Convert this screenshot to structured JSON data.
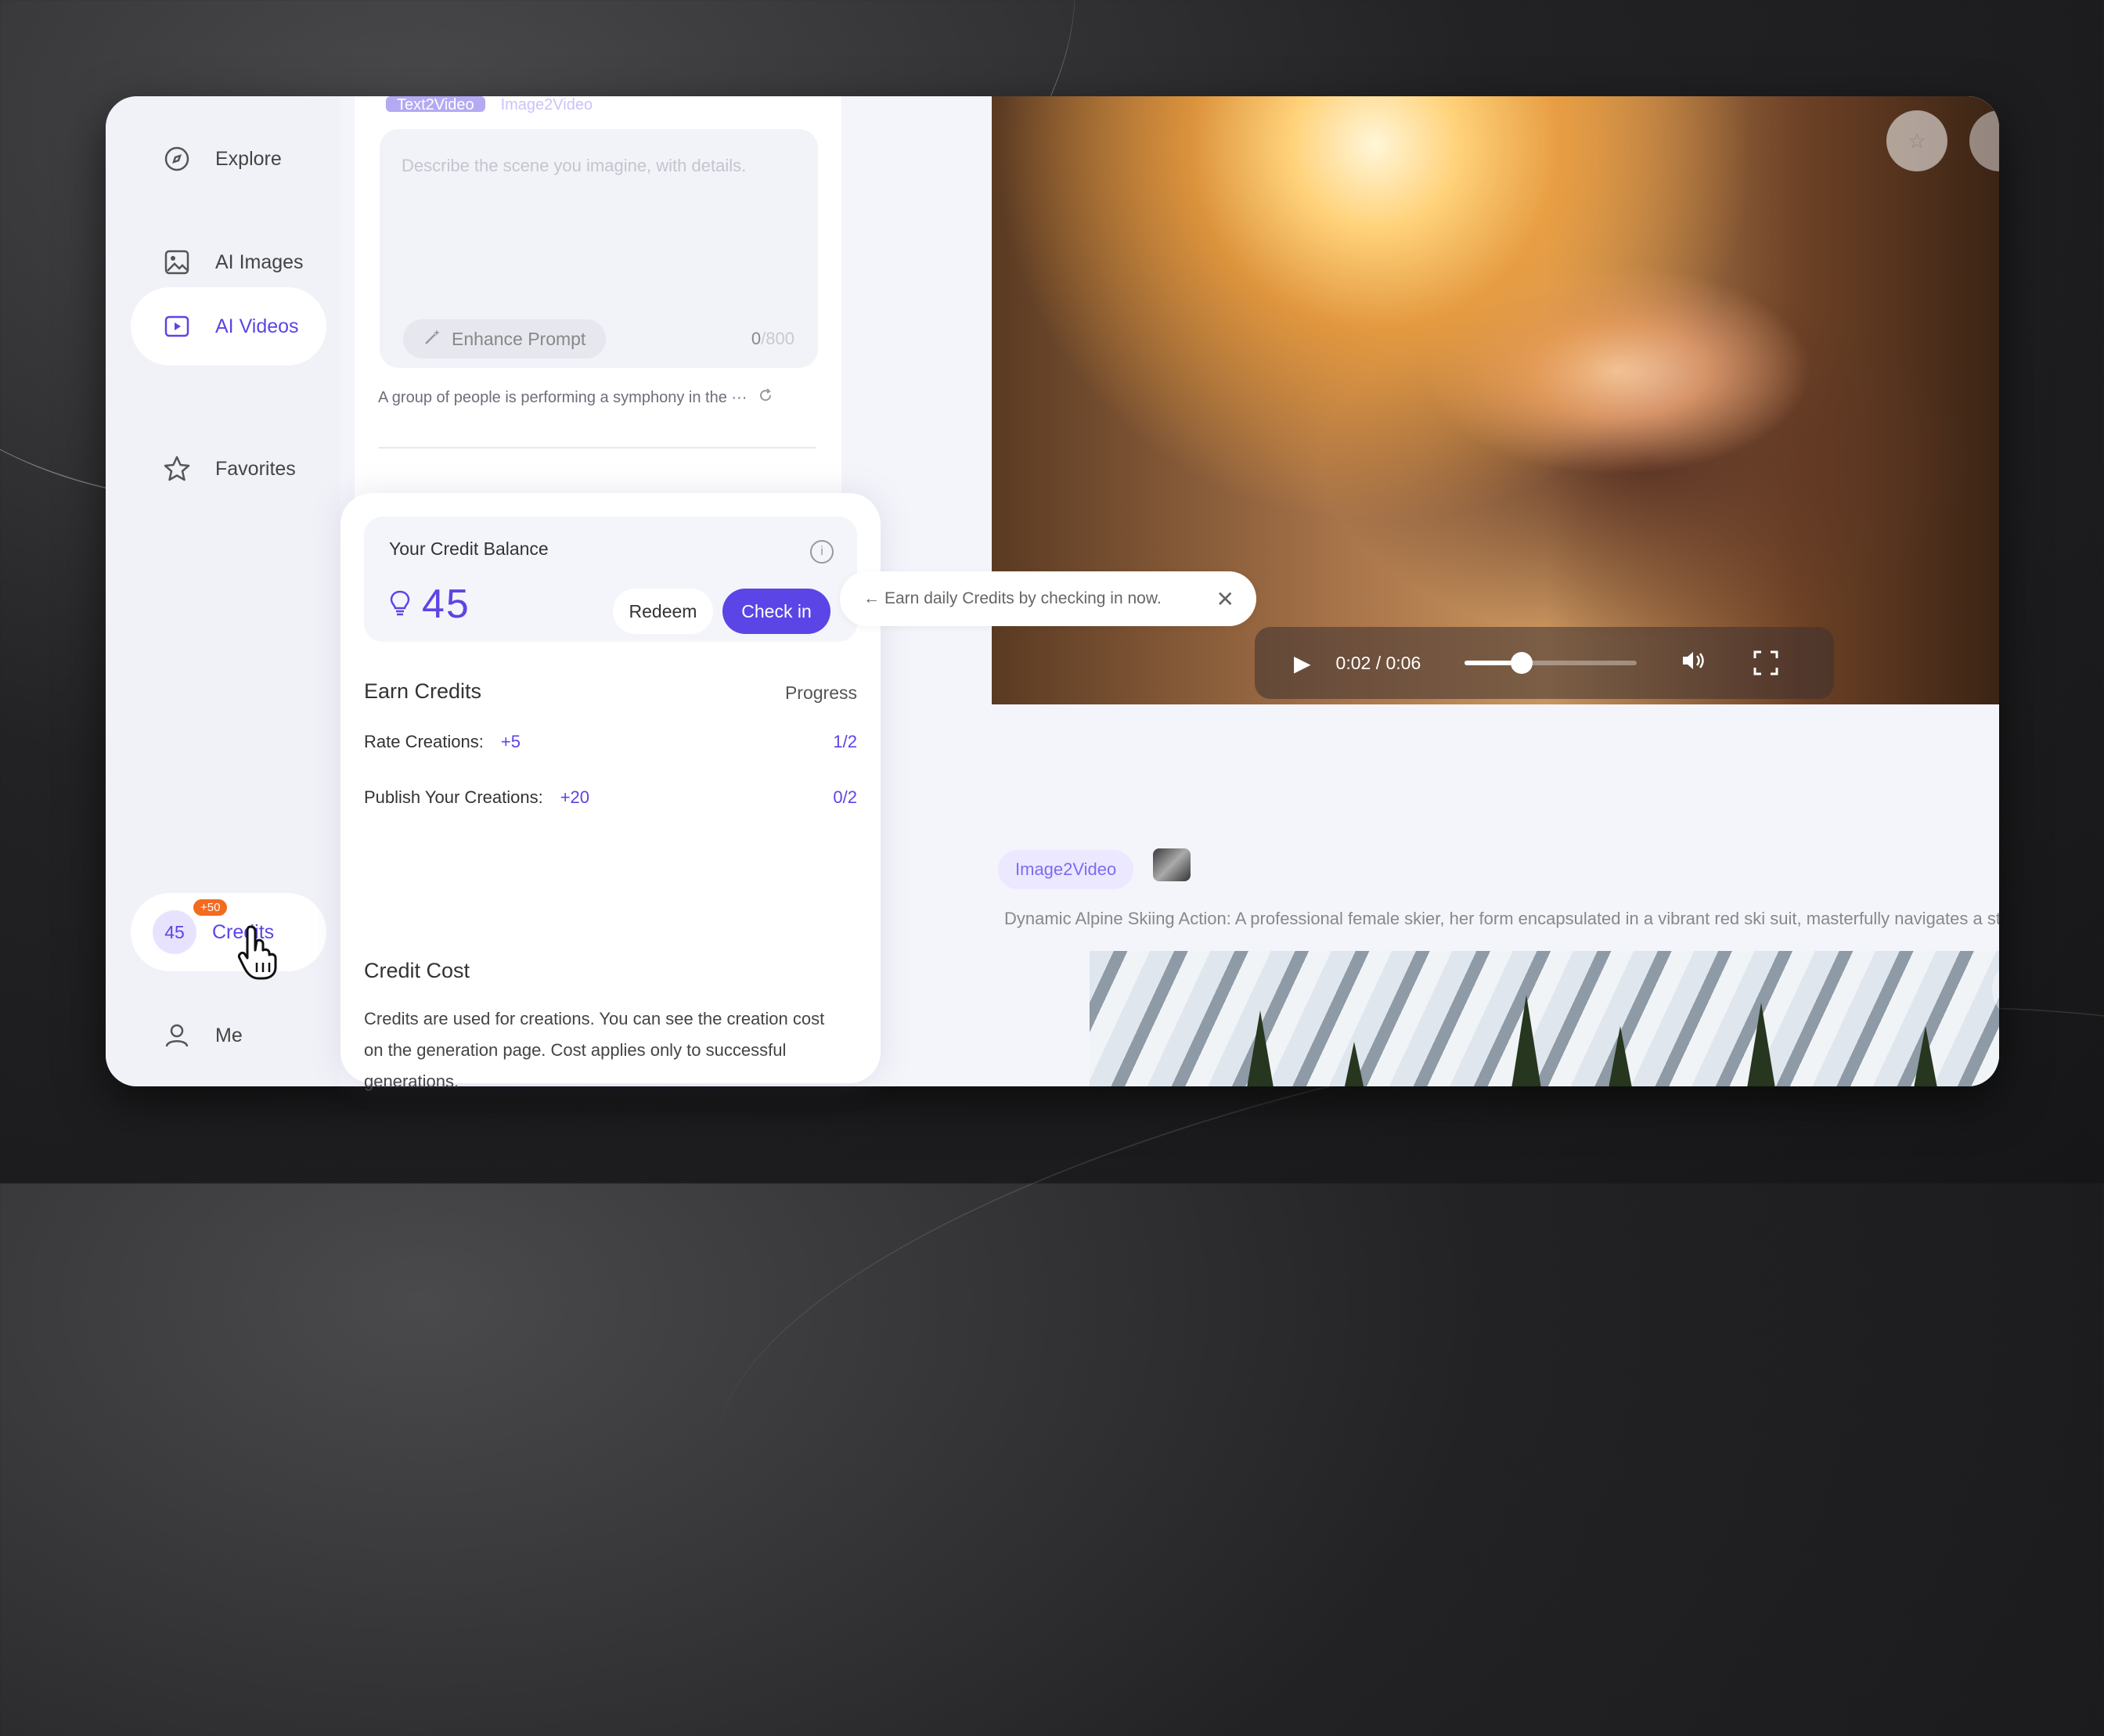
{
  "sidebar": {
    "items": [
      {
        "label": "Explore",
        "icon": "compass-icon"
      },
      {
        "label": "AI Images",
        "icon": "image-icon"
      },
      {
        "label": "AI Videos",
        "icon": "video-icon"
      },
      {
        "label": "Favorites",
        "icon": "star-icon"
      }
    ],
    "credits": {
      "count": "45",
      "label": "Credits",
      "badge": "+50"
    },
    "me": {
      "label": "Me",
      "icon": "user-icon"
    }
  },
  "prompt": {
    "tabs": [
      "Text2Video",
      "Image2Video"
    ],
    "placeholder": "Describe the scene you imagine, with details.",
    "enhance_label": "Enhance Prompt",
    "char_count": "0",
    "char_max": "/800",
    "suggestion": "A group of people is performing a symphony in the ···"
  },
  "credit_popup": {
    "balance_title": "Your Credit Balance",
    "balance": "45",
    "redeem_label": "Redeem",
    "checkin_label": "Check in",
    "earn_title": "Earn Credits",
    "progress_label": "Progress",
    "earn_items": [
      {
        "label": "Rate Creations:",
        "bonus": "+5",
        "progress": "1/2"
      },
      {
        "label": "Publish Your Creations:",
        "bonus": "+20",
        "progress": "0/2"
      }
    ],
    "cost_title": "Credit Cost",
    "cost_text": "Credits are used for creations. You can see the creation cost on the generation page. Cost applies only to successful generations."
  },
  "tooltip": {
    "text": "Earn daily Credits by checking in now.",
    "arrow": "←",
    "close": "✕"
  },
  "player": {
    "time": "0:02 / 0:06",
    "progress": 0.33
  },
  "feed": {
    "chip": "Image2Video",
    "description": "Dynamic Alpine Skiing Action: A professional female skier, her form encapsulated in a vibrant red ski suit, masterfully navigates a stee"
  },
  "colors": {
    "accent": "#5b45e6",
    "badge": "#f46a1f"
  }
}
